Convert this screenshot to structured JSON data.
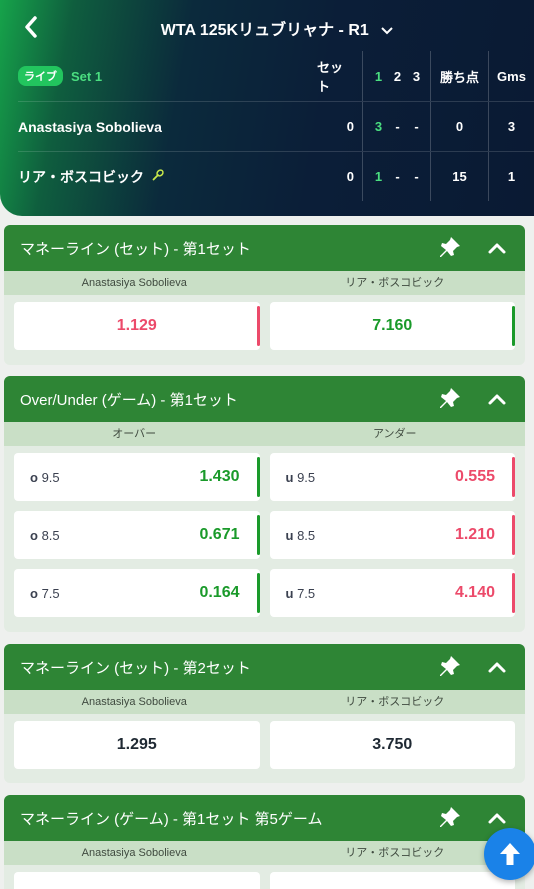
{
  "header": {
    "match_title": "WTA 125Kリュブリャナ - R1",
    "live_label": "ライブ",
    "set_label": "Set 1",
    "col_sets": "セット",
    "col_set_numbers": [
      "1",
      "2",
      "3"
    ],
    "col_points": "勝ち点",
    "col_games": "Gms",
    "players": [
      {
        "name": "Anastasiya Sobolieva",
        "sets": "0",
        "set_scores": [
          "3",
          "-",
          "-"
        ],
        "points": "0",
        "games": "3",
        "serving": false
      },
      {
        "name": "リア・ボスコビック",
        "sets": "0",
        "set_scores": [
          "1",
          "-",
          "-"
        ],
        "points": "15",
        "games": "1",
        "serving": true
      }
    ]
  },
  "markets": [
    {
      "title": "マネーライン (セット) - 第1セット",
      "columns": [
        "Anastasiya Sobolieva",
        "リア・ボスコビック"
      ],
      "rows": [
        [
          {
            "line": "",
            "odds": "1.129",
            "trend": "down"
          },
          {
            "line": "",
            "odds": "7.160",
            "trend": "up"
          }
        ]
      ]
    },
    {
      "title": "Over/Under (ゲーム) - 第1セット",
      "columns": [
        "オーバー",
        "アンダー"
      ],
      "rows": [
        [
          {
            "prefix": "o",
            "line": "9.5",
            "odds": "1.430",
            "trend": "up"
          },
          {
            "prefix": "u",
            "line": "9.5",
            "odds": "0.555",
            "trend": "down"
          }
        ],
        [
          {
            "prefix": "o",
            "line": "8.5",
            "odds": "0.671",
            "trend": "up"
          },
          {
            "prefix": "u",
            "line": "8.5",
            "odds": "1.210",
            "trend": "down"
          }
        ],
        [
          {
            "prefix": "o",
            "line": "7.5",
            "odds": "0.164",
            "trend": "up"
          },
          {
            "prefix": "u",
            "line": "7.5",
            "odds": "4.140",
            "trend": "down"
          }
        ]
      ]
    },
    {
      "title": "マネーライン (セット) - 第2セット",
      "columns": [
        "Anastasiya Sobolieva",
        "リア・ボスコビック"
      ],
      "rows": [
        [
          {
            "line": "",
            "odds": "1.295",
            "trend": "flat"
          },
          {
            "line": "",
            "odds": "3.750",
            "trend": "flat"
          }
        ]
      ]
    },
    {
      "title": "マネーライン (ゲーム) - 第1セット 第5ゲーム",
      "columns": [
        "Anastasiya Sobolieva",
        "リア・ボスコビック"
      ],
      "rows": []
    }
  ],
  "icons": {
    "back": "chevron-left-icon",
    "dropdown": "chevron-down-icon",
    "serve": "tennis-racket-icon",
    "pin": "pin-icon",
    "collapse": "chevron-up-icon",
    "scroll_top": "arrow-up-icon"
  },
  "colors": {
    "market_header": "#2e8535",
    "odds_up": "#1a9a2a",
    "odds_down": "#ec4a6a",
    "live_badge": "#22c55e",
    "scroll_top_button": "#1a82e8"
  }
}
